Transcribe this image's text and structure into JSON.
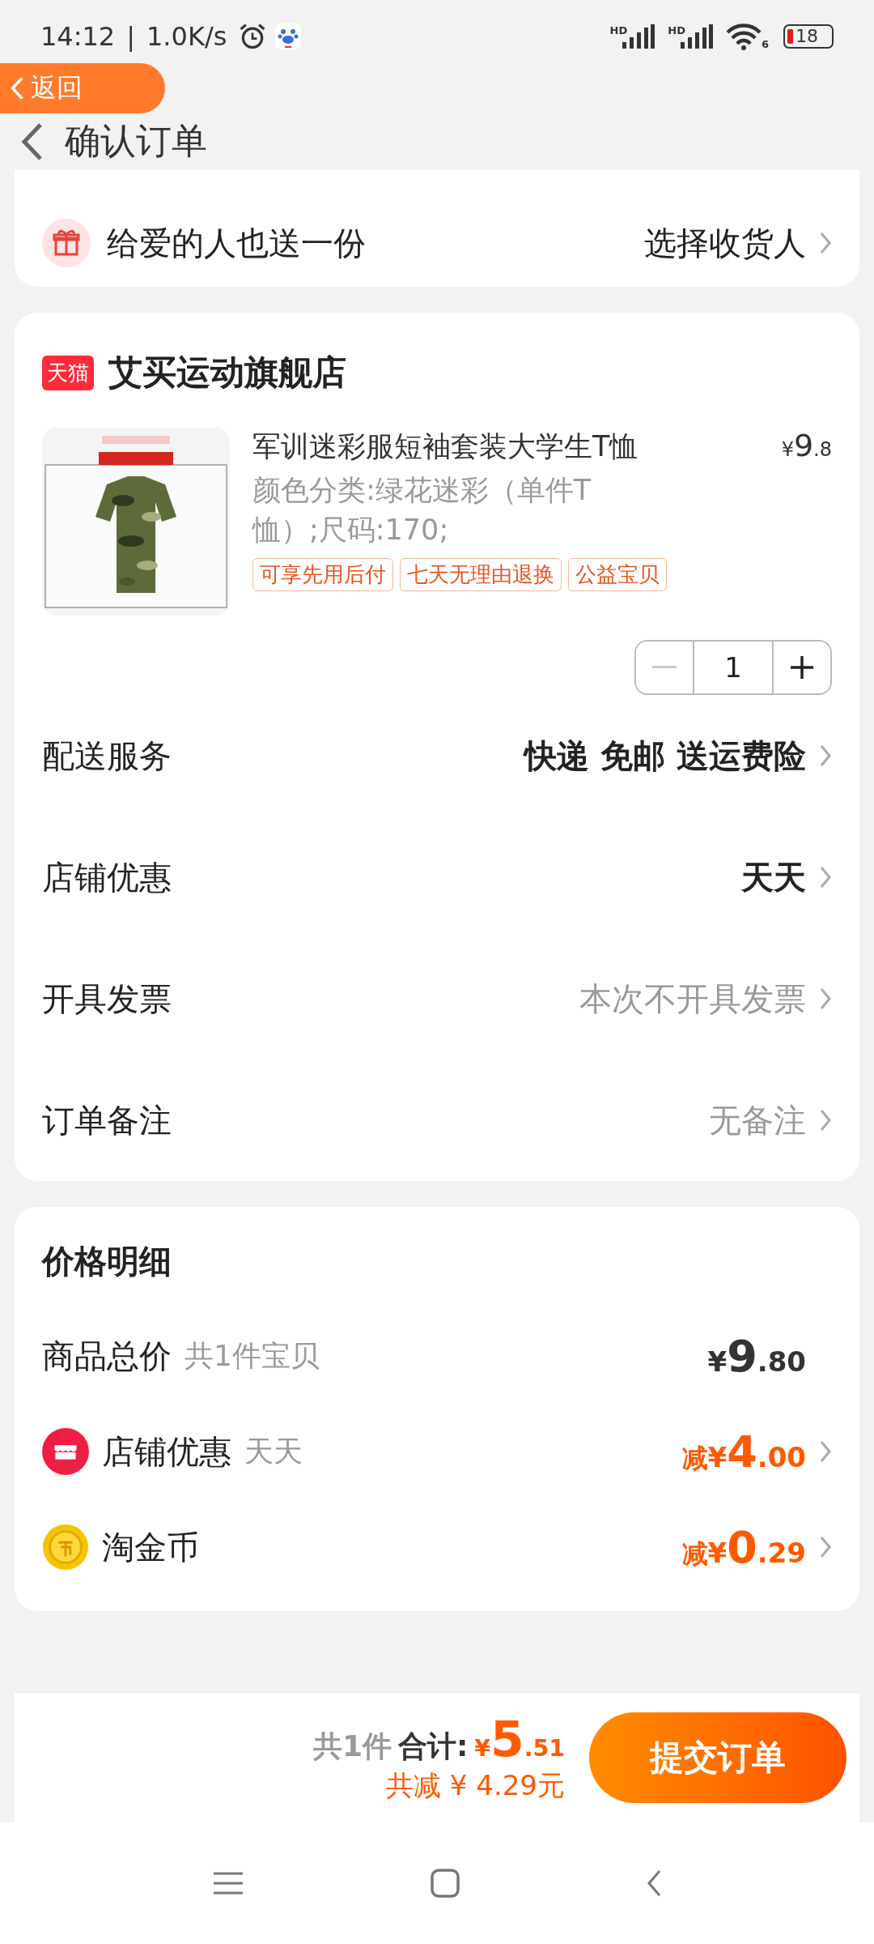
{
  "status_bar": {
    "time": "14:12",
    "separator": "|",
    "speed": "1.0K/s",
    "signals": [
      {
        "label": "HD"
      },
      {
        "label": "HD"
      }
    ],
    "wifi_label": "6",
    "battery": "18"
  },
  "header": {
    "back_button": "返回",
    "title": "确认订单"
  },
  "gift_row": {
    "label": "给爱的人也送一份",
    "action": "选择收货人"
  },
  "store": {
    "badge": "天猫",
    "name": "艾买运动旗舰店"
  },
  "product": {
    "title": "军训迷彩服短袖套装大学生T恤",
    "spec": "颜色分类:绿花迷彩（单件T恤）;尺码:170;",
    "price": {
      "currency": "¥",
      "integer": "9",
      "decimal": ".8"
    },
    "tags": [
      "可享先用后付",
      "七天无理由退换",
      "公益宝贝"
    ],
    "quantity": "1",
    "decrement_disabled": true
  },
  "service_rows": [
    {
      "label": "配送服务",
      "value": "快递 免邮 送运费险",
      "highlighted": true
    },
    {
      "label": "店铺优惠",
      "value": "天天",
      "highlighted": true
    },
    {
      "label": "开具发票",
      "value": "本次不开具发票",
      "highlighted": false
    },
    {
      "label": "订单备注",
      "value": "无备注",
      "highlighted": false
    }
  ],
  "price_details": {
    "title": "价格明细",
    "rows": [
      {
        "kind": "total",
        "label": "商品总价",
        "note": "共1件宝贝",
        "currency": "¥",
        "integer": "9",
        "decimal": ".80"
      },
      {
        "kind": "shop",
        "label": "店铺优惠",
        "note": "天天",
        "prefix": "减",
        "currency": "¥",
        "integer": "4",
        "decimal": ".00"
      },
      {
        "kind": "coin",
        "label": "淘金币",
        "prefix": "减",
        "currency": "¥",
        "integer": "0",
        "decimal": ".29"
      }
    ]
  },
  "footer": {
    "count": "共1件",
    "total_label": "合计:",
    "currency": "¥",
    "integer": "5",
    "decimal": ".51",
    "saving": "共减 ¥ 4.29元",
    "submit": "提交订单"
  }
}
